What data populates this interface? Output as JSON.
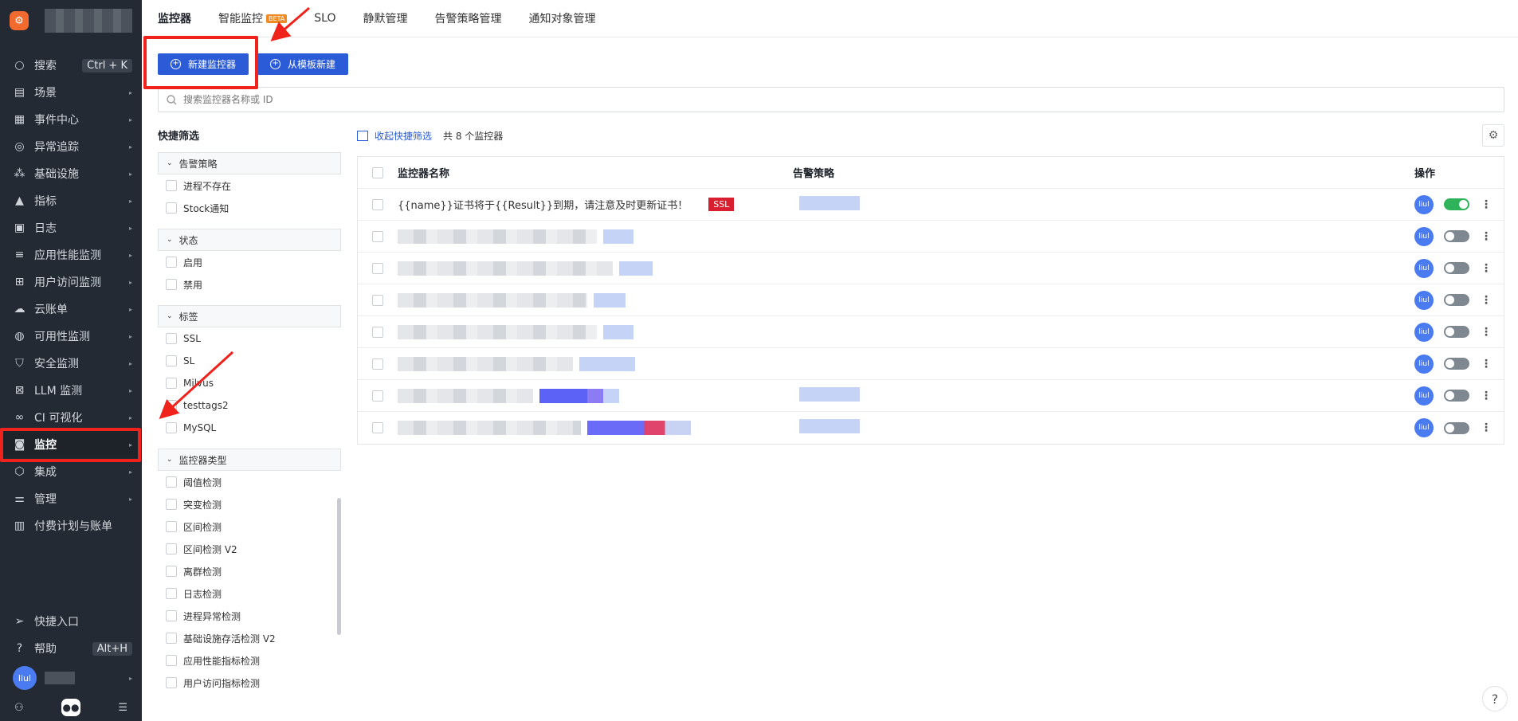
{
  "app": {
    "logo_letter": "⚙"
  },
  "sidebar": {
    "items": [
      {
        "label": "搜索",
        "icon": "search-icon",
        "glyph": "○",
        "kbd": "Ctrl + K"
      },
      {
        "label": "场景",
        "icon": "dashboard-icon",
        "glyph": "▤",
        "arrow": "▸"
      },
      {
        "label": "事件中心",
        "icon": "calendar-icon",
        "glyph": "▦",
        "arrow": "▸"
      },
      {
        "label": "异常追踪",
        "icon": "scan-icon",
        "glyph": "◎",
        "arrow": "▸"
      },
      {
        "label": "基础设施",
        "icon": "infrastructure-icon",
        "glyph": "⁂",
        "arrow": "▸"
      },
      {
        "label": "指标",
        "icon": "metrics-icon",
        "glyph": "▲",
        "arrow": "▸"
      },
      {
        "label": "日志",
        "icon": "logs-icon",
        "glyph": "▣",
        "arrow": "▸"
      },
      {
        "label": "应用性能监测",
        "icon": "apm-icon",
        "glyph": "≡",
        "arrow": "▸"
      },
      {
        "label": "用户访问监测",
        "icon": "rum-icon",
        "glyph": "⊞",
        "arrow": "▸"
      },
      {
        "label": "云账单",
        "icon": "cloud-billing-icon",
        "glyph": "☁",
        "arrow": "▸"
      },
      {
        "label": "可用性监测",
        "icon": "availability-icon",
        "glyph": "◍",
        "arrow": "▸"
      },
      {
        "label": "安全监测",
        "icon": "security-shield-icon",
        "glyph": "⛉",
        "arrow": "▸"
      },
      {
        "label": "LLM 监测",
        "icon": "llm-icon",
        "glyph": "⊠",
        "arrow": "▸"
      },
      {
        "label": "CI 可视化",
        "icon": "ci-icon",
        "glyph": "∞",
        "arrow": "▸"
      },
      {
        "label": "监控",
        "icon": "monitor-icon",
        "glyph": "◙",
        "arrow": "▸",
        "active": true
      },
      {
        "label": "集成",
        "icon": "integration-icon",
        "glyph": "⬡",
        "arrow": "▸"
      },
      {
        "label": "管理",
        "icon": "settings-sliders-icon",
        "glyph": "⚌",
        "arrow": "▸"
      },
      {
        "label": "付费计划与账单",
        "icon": "billing-icon",
        "glyph": "▥"
      }
    ],
    "bottom": [
      {
        "label": "快捷入口",
        "icon": "send-icon",
        "glyph": "➢"
      },
      {
        "label": "帮助",
        "icon": "help-circle-icon",
        "glyph": "?",
        "kbd": "Alt+H"
      }
    ],
    "user": {
      "avatar": "liul",
      "arrow": "▸"
    }
  },
  "tabs": [
    {
      "label": "监控器",
      "active": true
    },
    {
      "label": "智能监控",
      "badge": "BETA"
    },
    {
      "label": "SLO"
    },
    {
      "label": "静默管理"
    },
    {
      "label": "告警策略管理"
    },
    {
      "label": "通知对象管理"
    }
  ],
  "actions": {
    "new_monitor": "新建监控器",
    "from_template": "从模板新建"
  },
  "search": {
    "placeholder": "搜索监控器名称或 ID"
  },
  "filters": {
    "title": "快捷筛选",
    "groups": [
      {
        "title": "告警策略",
        "options": [
          "进程不存在",
          "Stock通知"
        ]
      },
      {
        "title": "状态",
        "options": [
          "启用",
          "禁用"
        ]
      },
      {
        "title": "标签",
        "options": [
          "SSL",
          "SL",
          "Milvus",
          "testtags2",
          "MySQL"
        ]
      },
      {
        "title": "监控器类型",
        "options": [
          "阈值检测",
          "突变检测",
          "区间检测",
          "区间检测 V2",
          "离群检测",
          "日志检测",
          "进程异常检测",
          "基础设施存活检测 V2",
          "应用性能指标检测",
          "用户访问指标检测"
        ]
      }
    ]
  },
  "toolbar": {
    "collapse": "收起快捷筛选",
    "count": "共 8 个监控器"
  },
  "table": {
    "headers": {
      "name": "监控器名称",
      "policy": "告警策略",
      "ops": "操作"
    },
    "rows": [
      {
        "name": "{{name}}证书将于{{Result}}到期，请注意及时更新证书！",
        "tag": "SSL",
        "owner": "liul",
        "enabled": true
      },
      {
        "owner": "liul",
        "enabled": false
      },
      {
        "owner": "liul",
        "enabled": false
      },
      {
        "owner": "liul",
        "enabled": false
      },
      {
        "owner": "liul",
        "enabled": false
      },
      {
        "owner": "liul",
        "enabled": false
      },
      {
        "owner": "liul",
        "enabled": false
      },
      {
        "owner": "liul",
        "enabled": false
      }
    ]
  },
  "help": "?",
  "colors": {
    "accent": "#2b5bd7",
    "sidebar": "#232a33",
    "highlight": "#f0231c",
    "toggle_on": "#2fb35a"
  }
}
